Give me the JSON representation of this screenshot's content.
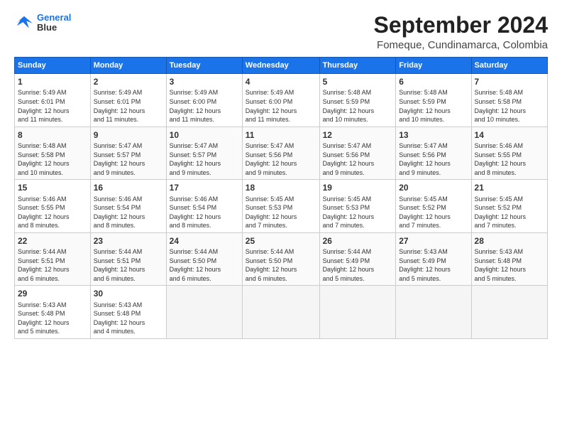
{
  "logo": {
    "line1": "General",
    "line2": "Blue"
  },
  "title": "September 2024",
  "subtitle": "Fomeque, Cundinamarca, Colombia",
  "days_of_week": [
    "Sunday",
    "Monday",
    "Tuesday",
    "Wednesday",
    "Thursday",
    "Friday",
    "Saturday"
  ],
  "weeks": [
    [
      {
        "day": "1",
        "info": "Sunrise: 5:49 AM\nSunset: 6:01 PM\nDaylight: 12 hours\nand 11 minutes."
      },
      {
        "day": "2",
        "info": "Sunrise: 5:49 AM\nSunset: 6:01 PM\nDaylight: 12 hours\nand 11 minutes."
      },
      {
        "day": "3",
        "info": "Sunrise: 5:49 AM\nSunset: 6:00 PM\nDaylight: 12 hours\nand 11 minutes."
      },
      {
        "day": "4",
        "info": "Sunrise: 5:49 AM\nSunset: 6:00 PM\nDaylight: 12 hours\nand 11 minutes."
      },
      {
        "day": "5",
        "info": "Sunrise: 5:48 AM\nSunset: 5:59 PM\nDaylight: 12 hours\nand 10 minutes."
      },
      {
        "day": "6",
        "info": "Sunrise: 5:48 AM\nSunset: 5:59 PM\nDaylight: 12 hours\nand 10 minutes."
      },
      {
        "day": "7",
        "info": "Sunrise: 5:48 AM\nSunset: 5:58 PM\nDaylight: 12 hours\nand 10 minutes."
      }
    ],
    [
      {
        "day": "8",
        "info": "Sunrise: 5:48 AM\nSunset: 5:58 PM\nDaylight: 12 hours\nand 10 minutes."
      },
      {
        "day": "9",
        "info": "Sunrise: 5:47 AM\nSunset: 5:57 PM\nDaylight: 12 hours\nand 9 minutes."
      },
      {
        "day": "10",
        "info": "Sunrise: 5:47 AM\nSunset: 5:57 PM\nDaylight: 12 hours\nand 9 minutes."
      },
      {
        "day": "11",
        "info": "Sunrise: 5:47 AM\nSunset: 5:56 PM\nDaylight: 12 hours\nand 9 minutes."
      },
      {
        "day": "12",
        "info": "Sunrise: 5:47 AM\nSunset: 5:56 PM\nDaylight: 12 hours\nand 9 minutes."
      },
      {
        "day": "13",
        "info": "Sunrise: 5:47 AM\nSunset: 5:56 PM\nDaylight: 12 hours\nand 9 minutes."
      },
      {
        "day": "14",
        "info": "Sunrise: 5:46 AM\nSunset: 5:55 PM\nDaylight: 12 hours\nand 8 minutes."
      }
    ],
    [
      {
        "day": "15",
        "info": "Sunrise: 5:46 AM\nSunset: 5:55 PM\nDaylight: 12 hours\nand 8 minutes."
      },
      {
        "day": "16",
        "info": "Sunrise: 5:46 AM\nSunset: 5:54 PM\nDaylight: 12 hours\nand 8 minutes."
      },
      {
        "day": "17",
        "info": "Sunrise: 5:46 AM\nSunset: 5:54 PM\nDaylight: 12 hours\nand 8 minutes."
      },
      {
        "day": "18",
        "info": "Sunrise: 5:45 AM\nSunset: 5:53 PM\nDaylight: 12 hours\nand 7 minutes."
      },
      {
        "day": "19",
        "info": "Sunrise: 5:45 AM\nSunset: 5:53 PM\nDaylight: 12 hours\nand 7 minutes."
      },
      {
        "day": "20",
        "info": "Sunrise: 5:45 AM\nSunset: 5:52 PM\nDaylight: 12 hours\nand 7 minutes."
      },
      {
        "day": "21",
        "info": "Sunrise: 5:45 AM\nSunset: 5:52 PM\nDaylight: 12 hours\nand 7 minutes."
      }
    ],
    [
      {
        "day": "22",
        "info": "Sunrise: 5:44 AM\nSunset: 5:51 PM\nDaylight: 12 hours\nand 6 minutes."
      },
      {
        "day": "23",
        "info": "Sunrise: 5:44 AM\nSunset: 5:51 PM\nDaylight: 12 hours\nand 6 minutes."
      },
      {
        "day": "24",
        "info": "Sunrise: 5:44 AM\nSunset: 5:50 PM\nDaylight: 12 hours\nand 6 minutes."
      },
      {
        "day": "25",
        "info": "Sunrise: 5:44 AM\nSunset: 5:50 PM\nDaylight: 12 hours\nand 6 minutes."
      },
      {
        "day": "26",
        "info": "Sunrise: 5:44 AM\nSunset: 5:49 PM\nDaylight: 12 hours\nand 5 minutes."
      },
      {
        "day": "27",
        "info": "Sunrise: 5:43 AM\nSunset: 5:49 PM\nDaylight: 12 hours\nand 5 minutes."
      },
      {
        "day": "28",
        "info": "Sunrise: 5:43 AM\nSunset: 5:48 PM\nDaylight: 12 hours\nand 5 minutes."
      }
    ],
    [
      {
        "day": "29",
        "info": "Sunrise: 5:43 AM\nSunset: 5:48 PM\nDaylight: 12 hours\nand 5 minutes."
      },
      {
        "day": "30",
        "info": "Sunrise: 5:43 AM\nSunset: 5:48 PM\nDaylight: 12 hours\nand 4 minutes."
      },
      {
        "day": "",
        "info": ""
      },
      {
        "day": "",
        "info": ""
      },
      {
        "day": "",
        "info": ""
      },
      {
        "day": "",
        "info": ""
      },
      {
        "day": "",
        "info": ""
      }
    ]
  ]
}
